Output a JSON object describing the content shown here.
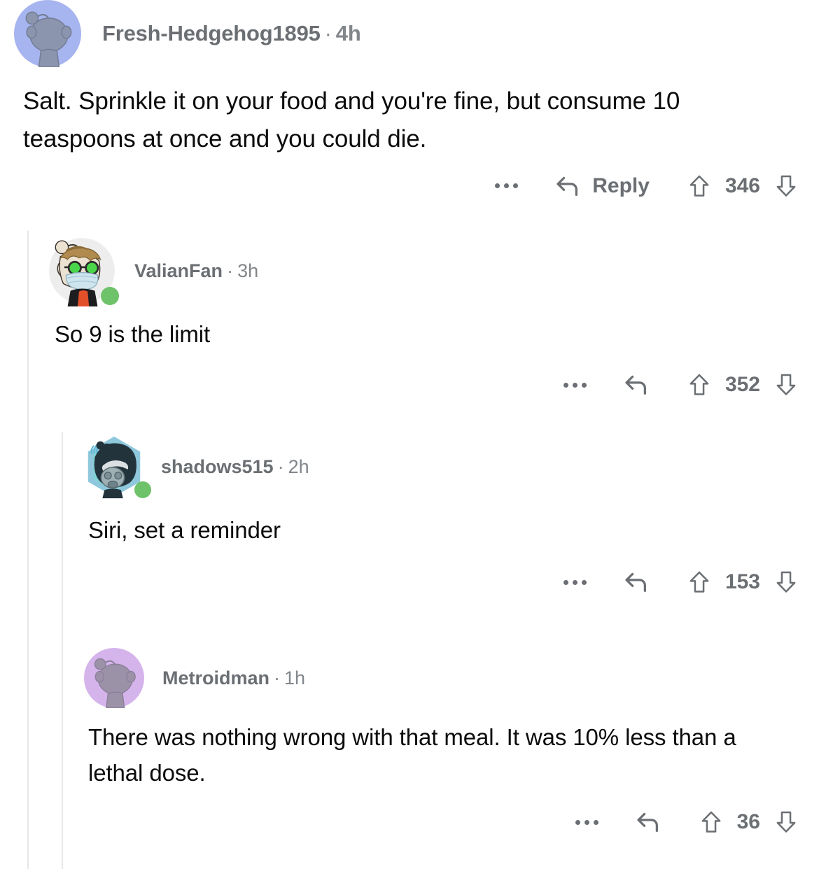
{
  "app": "reddit-comment-thread",
  "theme": {
    "background": "#ffffff",
    "text": "#0b0b0b",
    "meta": "#6b6f73",
    "threadline": "#e6e7e8",
    "online": "#6ec269"
  },
  "actions": {
    "overflow_label": "more options",
    "reply_label": "Reply",
    "upvote_label": "upvote",
    "downvote_label": "downvote"
  },
  "comments": [
    {
      "id": "c0",
      "depth": 0,
      "username": "Fresh-Hedgehog1895",
      "separator": "·",
      "age": "4h",
      "body": "Salt. Sprinkle it on your food and you're fine, but consume 10 teaspoons at once and you could die.",
      "score": "346",
      "show_reply_label": true,
      "avatar": {
        "type": "snoo-default",
        "background": "#a6b4ef",
        "body": "#8b95ad",
        "online": false
      }
    },
    {
      "id": "c1",
      "depth": 1,
      "username": "ValianFan",
      "separator": "·",
      "age": "3h",
      "body": "So 9 is the limit",
      "score": "352",
      "show_reply_label": false,
      "avatar": {
        "type": "snoo-masked-glasses",
        "background": "#ededed",
        "hair": "#b08a4e",
        "mask": "#cfe5ee",
        "jacket": "#1d1d1f",
        "shirt": "#e2502a",
        "eyes": "#4ad64a",
        "online": true
      }
    },
    {
      "id": "c2",
      "depth": 2,
      "username": "shadows515",
      "separator": "·",
      "age": "2h",
      "body": "Siri, set a reminder",
      "score": "153",
      "show_reply_label": false,
      "avatar": {
        "type": "snoo-hooded-gasmask",
        "background": "#8fc8dd",
        "hood": "#23333c",
        "mask": "#9fb0b5",
        "signal": "#59b9d8",
        "online": true
      }
    },
    {
      "id": "c3",
      "depth": 2,
      "username": "Metroidman",
      "separator": "·",
      "age": "1h",
      "body": "There was nothing wrong with that meal. It was 10% less than a lethal dose.",
      "score": "36",
      "show_reply_label": false,
      "avatar": {
        "type": "snoo-default",
        "background": "#d5b4ec",
        "body": "#9c92a8",
        "online": false
      }
    }
  ]
}
